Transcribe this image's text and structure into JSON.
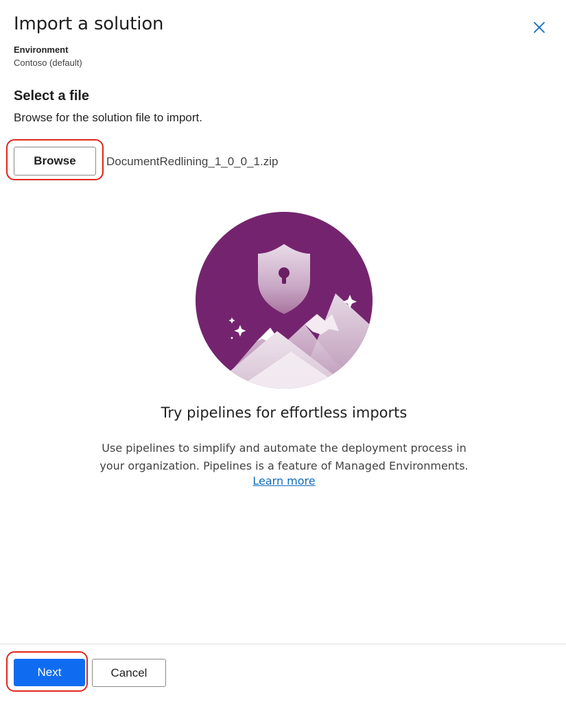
{
  "dialog": {
    "title": "Import a solution",
    "close_icon": "close-icon"
  },
  "environment": {
    "label": "Environment",
    "value": "Contoso (default)"
  },
  "file_section": {
    "title": "Select a file",
    "description": "Browse for the solution file to import.",
    "browse_label": "Browse",
    "selected_file": "DocumentRedlining_1_0_0_1.zip"
  },
  "promo": {
    "illustration_icon": "shield-mountains-illustration",
    "title": "Try pipelines for effortless imports",
    "body_line1": "Use pipelines to simplify and automate the deployment process in",
    "body_line2": "your organization. Pipelines is a feature of Managed Environments.",
    "link": "Learn more"
  },
  "footer": {
    "next_label": "Next",
    "cancel_label": "Cancel"
  },
  "colors": {
    "primary": "#0f6cf0",
    "link": "#0f6cbd",
    "highlight": "#e0261c",
    "illustration_purple": "#74246e"
  }
}
